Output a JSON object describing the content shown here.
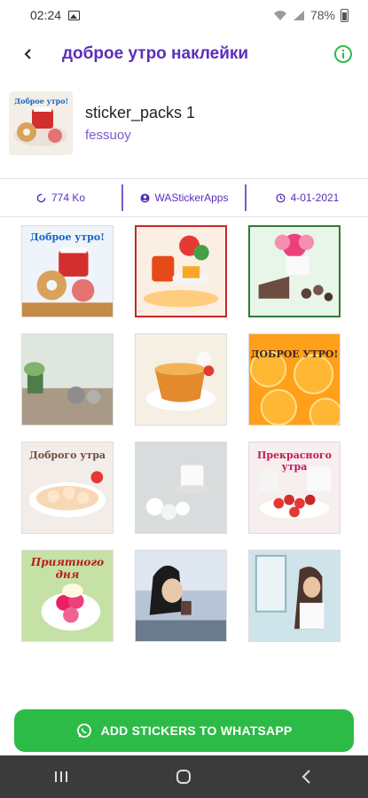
{
  "status_bar": {
    "time": "02:24",
    "battery": "78%"
  },
  "app_bar": {
    "title": "доброе утро наклейки",
    "back_icon": "arrow-back-icon",
    "info_icon": "info-circle-icon"
  },
  "pack": {
    "name": "sticker_packs 1",
    "author": "fessuoy"
  },
  "info": {
    "size": "774 Ko",
    "publisher": "WAStickerApps",
    "date": "4-01-2021"
  },
  "stickers": [
    {
      "caption": "Доброе утро!"
    },
    {
      "caption": ""
    },
    {
      "caption": ""
    },
    {
      "caption": ""
    },
    {
      "caption": ""
    },
    {
      "caption": "ДОБРОЕ УТРО!"
    },
    {
      "caption": "Доброго утра"
    },
    {
      "caption": ""
    },
    {
      "caption": "Прекрасного утра"
    },
    {
      "caption": "Приятного дня"
    },
    {
      "caption": ""
    },
    {
      "caption": ""
    }
  ],
  "cta": {
    "label": "ADD STICKERS TO WHATSAPP",
    "color": "#2dbb48"
  },
  "colors": {
    "accent": "#5b2fb8",
    "author": "#7c59c8"
  }
}
